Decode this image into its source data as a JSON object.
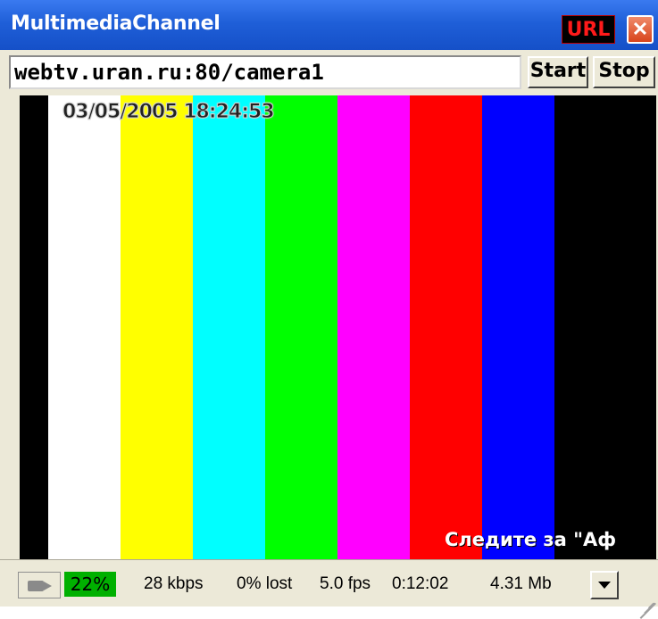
{
  "window": {
    "title": "MultimediaChannel",
    "url_badge": "URL",
    "close_glyph": "✕"
  },
  "address_bar": {
    "url_value": "webtv.uran.ru:80/camera1",
    "start_label": "Start",
    "stop_label": "Stop"
  },
  "video": {
    "timestamp": "03/05/2005 18:24:53",
    "caption": "Следите за \"Аф",
    "bars": [
      {
        "color": "#ffffff",
        "name": "white"
      },
      {
        "color": "#ffff00",
        "name": "yellow"
      },
      {
        "color": "#00ffff",
        "name": "cyan"
      },
      {
        "color": "#00ff00",
        "name": "green"
      },
      {
        "color": "#ff00ff",
        "name": "magenta"
      },
      {
        "color": "#ff0000",
        "name": "red"
      },
      {
        "color": "#0000ff",
        "name": "blue"
      },
      {
        "color": "#000000",
        "name": "black"
      }
    ]
  },
  "status": {
    "camera_icon": "video-camera-icon",
    "level": "22%",
    "bitrate": "28 kbps",
    "lost": "0% lost",
    "fps": "5.0 fps",
    "duration": "0:12:02",
    "size": "4.31 Mb",
    "menu_icon": "chevron-down-icon"
  }
}
